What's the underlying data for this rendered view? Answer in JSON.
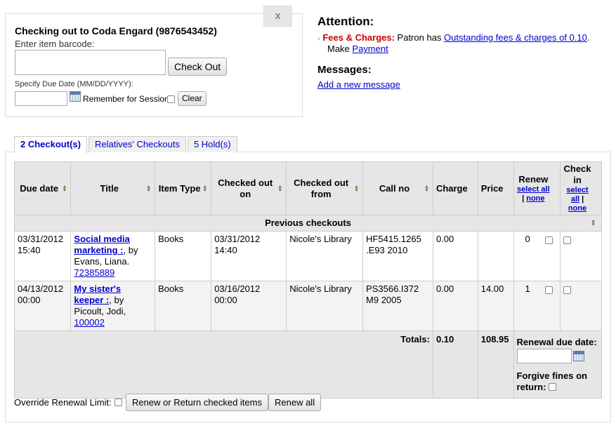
{
  "checkout": {
    "close_label": "x",
    "title": "Checking out to Coda Engard (9876543452)",
    "barcode_label": "Enter item barcode:",
    "barcode_value": "",
    "checkout_button": "Check Out",
    "due_label": "Specify Due Date (MM/DD/YYYY):",
    "due_value": "",
    "remember_label": "Remember for Session:",
    "clear_button": "Clear"
  },
  "attention": {
    "title": "Attention:",
    "fees_label": "Fees & Charges:",
    "fees_text": " Patron has ",
    "fees_link": "Outstanding fees & charges of 0.10",
    "fees_end": ".",
    "make_text": "Make ",
    "payment_link": "Payment",
    "messages_title": "Messages:",
    "add_message_link": "Add a new message"
  },
  "tabs": [
    {
      "label": "2 Checkout(s)",
      "active": true
    },
    {
      "label": "Relatives' Checkouts",
      "active": false
    },
    {
      "label": "5 Hold(s)",
      "active": false
    }
  ],
  "table": {
    "headers": {
      "due_date": "Due date",
      "title": "Title",
      "item_type": "Item Type",
      "checked_out_on": "Checked out on",
      "checked_out_from": "Checked out from",
      "call_no": "Call no",
      "charge": "Charge",
      "price": "Price",
      "renew": "Renew",
      "check_in": "Check in",
      "select_all": "select all",
      "sep": " | ",
      "none": "none"
    },
    "group_label": "Previous checkouts",
    "rows": [
      {
        "due_date": "03/31/2012 15:40",
        "title": "Social media marketing :",
        "author": ", by Evans, Liana.",
        "barcode": "72385889",
        "item_type": "Books",
        "checked_out_on": "03/31/2012 14:40",
        "checked_out_from": "Nicole's Library",
        "call_no": "HF5415.1265 .E93 2010",
        "charge": "0.00",
        "price": "",
        "renew_count": "0"
      },
      {
        "due_date": "04/13/2012 00:00",
        "title": "My sister's keeper :",
        "author": ", by Picoult, Jodi,",
        "barcode": "100002",
        "item_type": "Books",
        "checked_out_on": "03/16/2012 00:00",
        "checked_out_from": "Nicole's Library",
        "call_no": "PS3566.I372 M9 2005",
        "charge": "0.00",
        "price": "14.00",
        "renew_count": "1"
      }
    ],
    "totals": {
      "label": "Totals:",
      "charge": "0.10",
      "price": "108.95",
      "renewal_due_label": "Renewal due date:",
      "renewal_due_value": "",
      "forgive_label": "Forgive fines on return:"
    }
  },
  "footer": {
    "override_label": "Override Renewal Limit:",
    "renew_return_button": "Renew or Return checked items",
    "renew_all_button": "Renew all"
  }
}
